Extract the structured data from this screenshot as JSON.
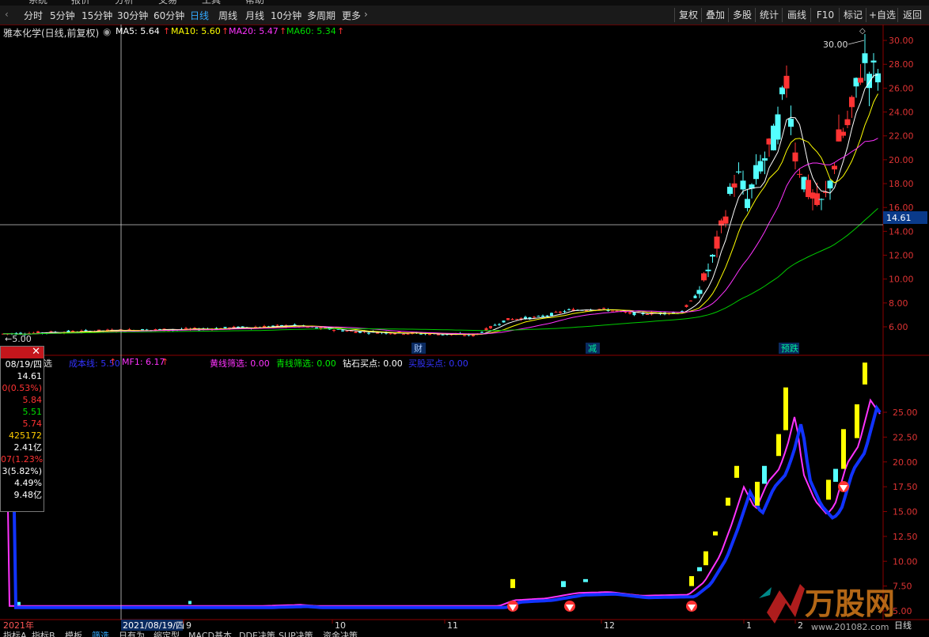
{
  "top_strip": [
    "系统",
    "报价",
    "分析",
    "交易",
    "工具",
    "帮助"
  ],
  "toolbar": {
    "periods": [
      "分时",
      "5分钟",
      "15分钟",
      "30分钟",
      "60分钟",
      "日线",
      "周线",
      "月线",
      "10分钟",
      "多周期",
      "更多"
    ],
    "active_period": "日线",
    "buttons": [
      "复权",
      "叠加",
      "多股",
      "统计",
      "画线",
      "F10",
      "标记",
      "+自选",
      "返回"
    ]
  },
  "stock": {
    "title": "雅本化学(日线,前复权)"
  },
  "ma": [
    {
      "label": "MA5: 5.64",
      "color": "#ffffff"
    },
    {
      "label": "MA10: 5.60",
      "color": "#ffff00"
    },
    {
      "label": "MA20: 5.47",
      "color": "#ff33ff"
    },
    {
      "label": "MA60: 5.34",
      "color": "#00dd00"
    }
  ],
  "price_axis": [
    "30.00",
    "28.00",
    "26.00",
    "24.00",
    "22.00",
    "20.00",
    "18.00",
    "16.00",
    "14.00",
    "12.00",
    "10.00",
    "8.00",
    "6.00"
  ],
  "crosshair_price": "14.61",
  "max_marker": "30.00",
  "min_marker": "5.00",
  "events": [
    "财",
    "减",
    "预跌"
  ],
  "indicator": {
    "title": "选",
    "items": [
      {
        "label": "成本线: 5.50",
        "color": "#3333ff"
      },
      {
        "label": "MF1: 6.17",
        "color": "#ff33ff"
      },
      {
        "label": "黄线筛选: 0.00",
        "color": "#ff33ff"
      },
      {
        "label": "青线筛选: 0.00",
        "color": "#00ee00"
      },
      {
        "label": "钻石买点: 0.00",
        "color": "#ffffff"
      },
      {
        "label": "买股买点: 0.00",
        "color": "#3333ff"
      }
    ],
    "axis": [
      "25.00",
      "22.50",
      "20.00",
      "17.50",
      "15.00",
      "12.50",
      "10.00",
      "7.50",
      "5.00"
    ]
  },
  "info_box": {
    "values": [
      {
        "text": "08/19/四",
        "color": "#ffffff"
      },
      {
        "text": "14.61",
        "color": "#ffffff"
      },
      {
        "text": "0(0.53%)",
        "color": "#ff3333"
      },
      {
        "text": "5.84",
        "color": "#ff3333"
      },
      {
        "text": "5.51",
        "color": "#00dd00"
      },
      {
        "text": "5.74",
        "color": "#ff3333"
      },
      {
        "text": "425172",
        "color": "#ffcc00"
      },
      {
        "text": "2.41亿",
        "color": "#ffffff"
      },
      {
        "text": "07(1.23%)",
        "color": "#ff3333"
      },
      {
        "text": "3(5.82%)",
        "color": "#ffffff"
      },
      {
        "text": "4.49%",
        "color": "#ffffff"
      },
      {
        "text": "9.48亿",
        "color": "#ffffff"
      }
    ]
  },
  "date_axis": {
    "year": "2021年",
    "cursor_date": "2021/08/19/四",
    "months": [
      "9",
      "10",
      "11",
      "12",
      "1",
      "2"
    ],
    "right": "日线"
  },
  "bottom_tabs": [
    "指标A",
    "指标B",
    "模板",
    "筛选",
    "日有为",
    "缩定型",
    "MACD基本",
    "DDE决策",
    "SUP决策",
    "资金决策"
  ],
  "watermark": {
    "brand": "万股网",
    "url": "www.201082.com"
  }
}
